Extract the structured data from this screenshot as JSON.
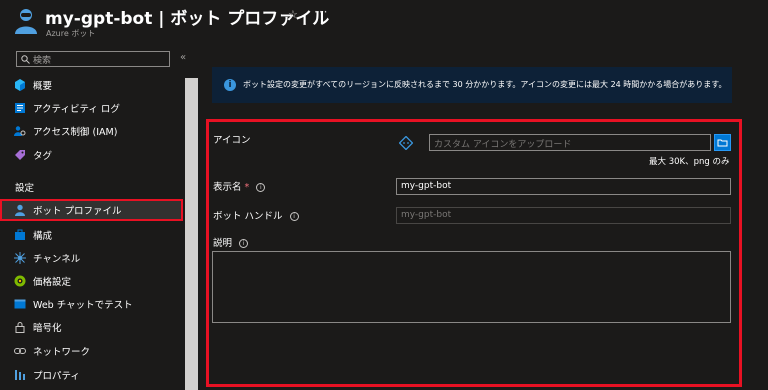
{
  "header": {
    "title": "my-gpt-bot | ボット プロファイル",
    "subtitle": "Azure ボット",
    "star_icon": "star-outline-icon",
    "more_icon": "more-icon"
  },
  "sidebar": {
    "search_placeholder": "検索",
    "items": [
      {
        "label": "概要",
        "icon": "overview-icon",
        "color": "#29b6f6"
      },
      {
        "label": "アクティビティ ログ",
        "icon": "activity-log-icon",
        "color": "#0078d4"
      },
      {
        "label": "アクセス制御 (IAM)",
        "icon": "access-control-icon",
        "color": "#0078d4"
      },
      {
        "label": "タグ",
        "icon": "tag-icon",
        "color": "#a66ed6"
      }
    ],
    "section_label": "設定",
    "settings_items": [
      {
        "label": "ボット プロファイル",
        "icon": "bot-profile-icon",
        "color": "#50a0e0"
      },
      {
        "label": "構成",
        "icon": "configuration-icon",
        "color": "#0078d4"
      },
      {
        "label": "チャンネル",
        "icon": "channels-icon",
        "color": "#50a0e0"
      },
      {
        "label": "価格設定",
        "icon": "pricing-icon",
        "color": "#7fba00"
      },
      {
        "label": "Web チャットでテスト",
        "icon": "web-chat-icon",
        "color": "#0078d4"
      },
      {
        "label": "暗号化",
        "icon": "lock-icon",
        "color": "#c8c6c4"
      },
      {
        "label": "ネットワーク",
        "icon": "network-icon",
        "color": "#c8c6c4"
      },
      {
        "label": "プロパティ",
        "icon": "properties-icon",
        "color": "#50a0e0"
      }
    ]
  },
  "banner": {
    "text": "ボット設定の変更がすべてのリージョンに反映されるまで 30 分かかります。アイコンの変更には最大 24 時間かかる場合があります。"
  },
  "form": {
    "icon_label": "アイコン",
    "icon_placeholder": "カスタム アイコンをアップロード",
    "icon_hint": "最大 30K、png のみ",
    "display_name_label": "表示名",
    "required_mark": "*",
    "display_name_value": "my-gpt-bot",
    "bot_handle_label": "ボット ハンドル",
    "bot_handle_value": "my-gpt-bot",
    "description_label": "説明",
    "info_glyph": "i"
  },
  "colors": {
    "accent": "#0078d4",
    "highlight": "#e81123",
    "banner_bg": "#0d2137"
  }
}
